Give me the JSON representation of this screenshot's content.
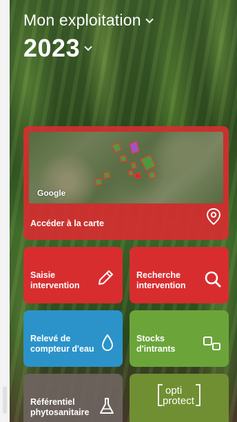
{
  "header": {
    "farm_name": "Mon exploitation",
    "year": "2023"
  },
  "map_card": {
    "label": "Accéder à la carte",
    "map_brand": "Google"
  },
  "tiles": {
    "saisie": {
      "line1": "Saisie",
      "line2": "intervention"
    },
    "recherche": {
      "line1": "Recherche",
      "line2": "intervention"
    },
    "releve": {
      "line1": "Relevé de",
      "line2": "compteur d'eau"
    },
    "stocks": {
      "line1": "Stocks",
      "line2": "d'intrants"
    },
    "referentiel": {
      "line1": "Référentiel",
      "line2": "phytosanitaire"
    },
    "optiprotect": {
      "line1": "opti",
      "line2": "protect"
    }
  },
  "colors": {
    "red": "#d82d2f",
    "blue": "#2b93c9",
    "green": "#6ba53a",
    "olive": "#708f32",
    "grey": "#6e645f"
  },
  "icons": {
    "farm_chevron": "chevron-down-icon",
    "year_chevron": "chevron-down-icon",
    "map": "map-pin-icon",
    "saisie": "pencil-icon",
    "recherche": "search-icon",
    "releve": "water-drop-icon",
    "stocks": "stock-boxes-icon",
    "referentiel": "flask-icon"
  }
}
